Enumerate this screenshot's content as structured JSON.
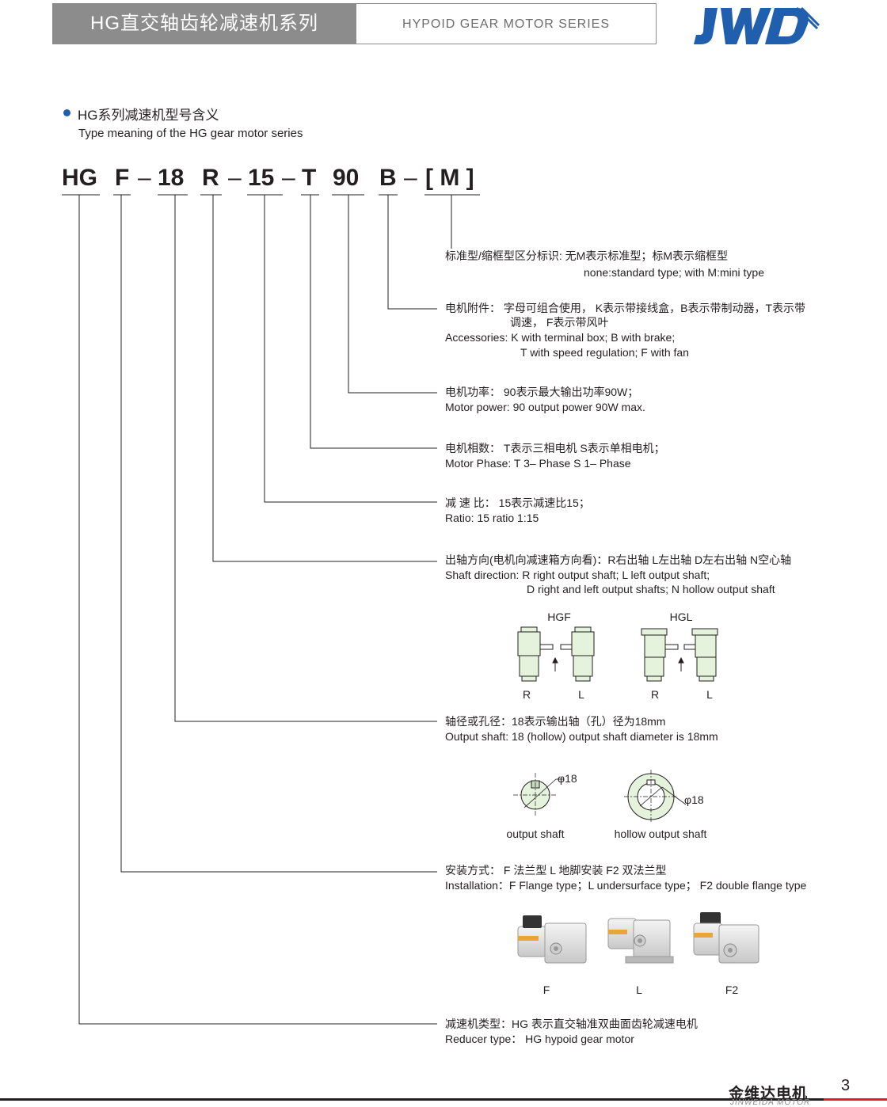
{
  "header": {
    "title_cn": "HG直交轴齿轮减速机系列",
    "title_en": "HYPOID GEAR MOTOR SERIES",
    "logo_text": "JWD"
  },
  "section": {
    "title": "HG系列减速机型号含义",
    "subtitle": "Type meaning of the HG gear motor series"
  },
  "model_code": {
    "parts": [
      "HG",
      "F",
      "–",
      "18",
      "R",
      "–",
      "15",
      "–",
      "T",
      "90",
      "B",
      "–",
      "[ M ]"
    ]
  },
  "descriptions": {
    "m": {
      "line1": "标准型/缩框型区分标识:  无M表示标准型；标M表示缩框型",
      "line2": "none:standard type; with M:mini type"
    },
    "b": {
      "line1": "电机附件：  字母可组合使用， K表示带接线盒，B表示带制动器，T表示带",
      "line2": "调速， F表示带风叶",
      "line3": "Accessories:   K with terminal box;   B with brake;",
      "line4": "T with speed regulation;   F with fan"
    },
    "power": {
      "line1": "电机功率：   90表示最大输出功率90W；",
      "line2": "Motor power:    90 output power 90W max."
    },
    "phase": {
      "line1": "电机相数：   T表示三相电机  S表示单相电机；",
      "line2": "Motor Phase:    T 3– Phase    S 1– Phase"
    },
    "ratio": {
      "line1": "减 速 比：   15表示减速比15；",
      "line2": "Ratio:          15 ratio 1:15"
    },
    "shaft_dir": {
      "line1": "出轴方向(电机向减速箱方向看)：R右出轴  L左出轴  D左右出轴  N空心轴",
      "line2": "Shaft direction: R right output shaft;    L left output shaft;",
      "line3": "D right and left output shafts;   N hollow output shaft"
    },
    "shaft_dia": {
      "line1": "轴径或孔径：18表示输出轴（孔）径为18mm",
      "line2": "Output shaft:    18 (hollow) output shaft diameter is 18mm"
    },
    "install": {
      "line1": "安装方式：  F 法兰型  L 地脚安装  F2 双法兰型",
      "line2": "Installation：F Flange type；L undersurface type；  F2 double flange type"
    },
    "reducer": {
      "line1": "减速机类型：HG 表示直交轴准双曲面齿轮减速电机",
      "line2": "Reducer type：  HG hypoid gear motor"
    }
  },
  "shaft_direction_figs": {
    "hgf": "HGF",
    "hgl": "HGL",
    "labels": [
      "R",
      "L",
      "R",
      "L"
    ]
  },
  "shaft_figs": {
    "dia1": "φ18",
    "dia2": "φ18",
    "output": "output shaft",
    "hollow": "hollow output shaft"
  },
  "install_figs": {
    "labels": [
      "F",
      "L",
      "F2"
    ]
  },
  "footer": {
    "company_cn": "金维达电机",
    "company_en": "JINWEIDA MOTOR",
    "page": "3"
  },
  "colors": {
    "accent_blue": "#1f5fae",
    "header_gray": "#8c8c8c",
    "footer_red": "#d7261e",
    "drawing_fill": "#e6f3dc"
  }
}
